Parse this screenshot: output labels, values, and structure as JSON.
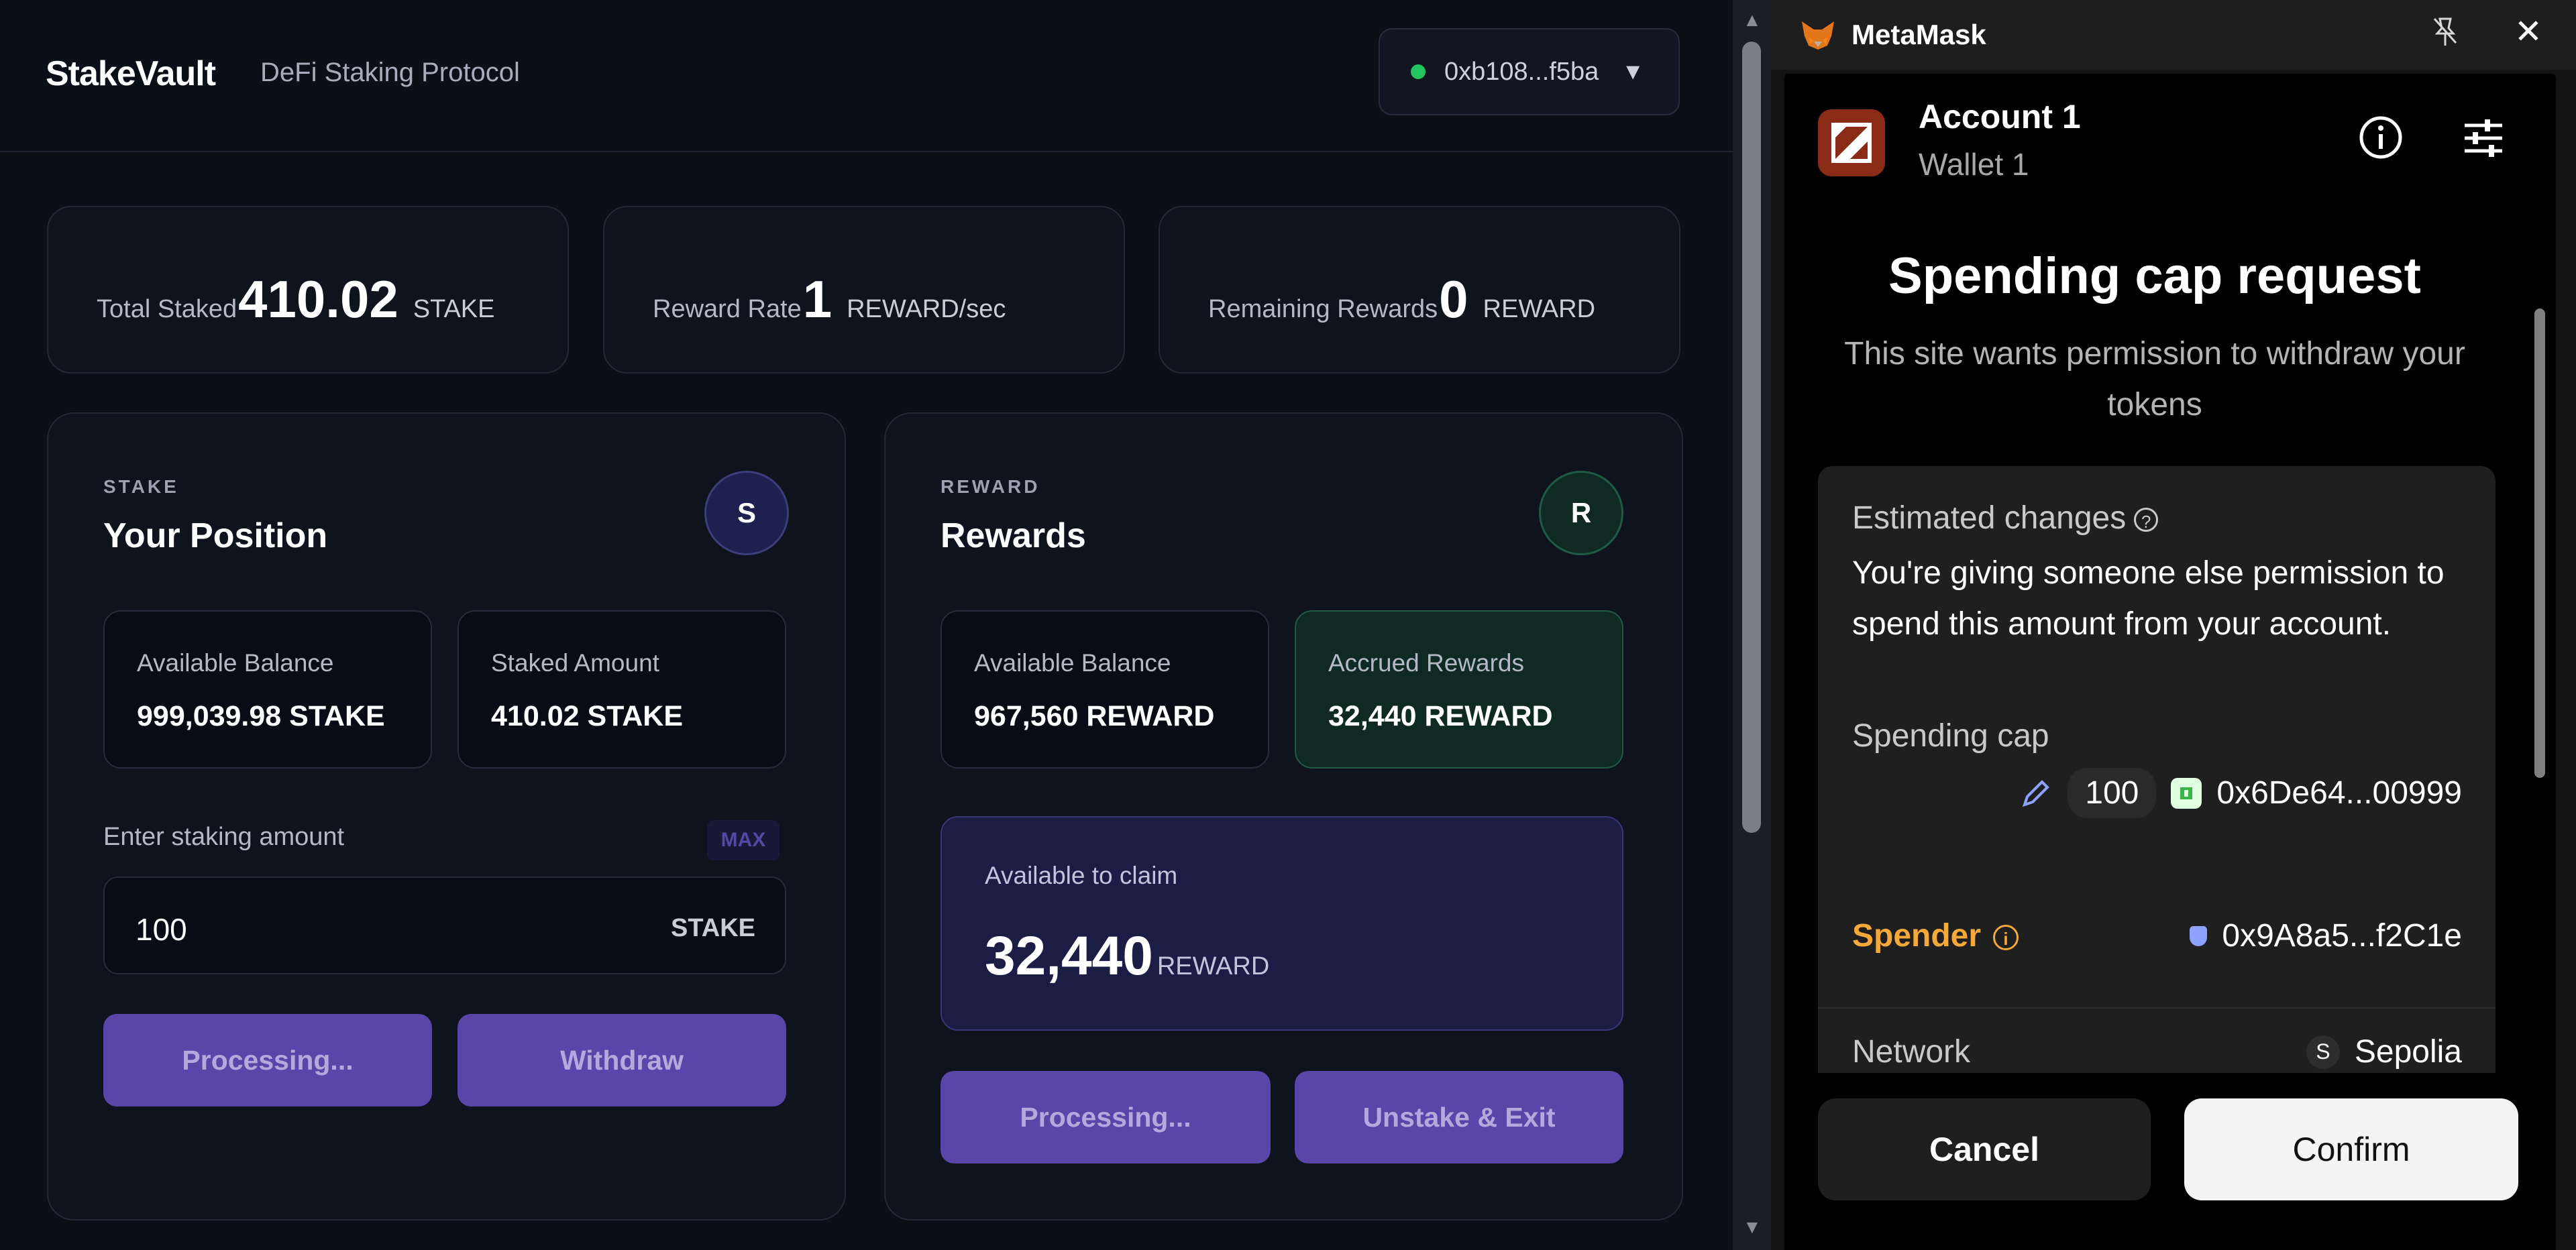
{
  "dapp": {
    "brand": "StakeVault",
    "tagline": "DeFi Staking Protocol",
    "wallet_address": "0xb108...f5ba",
    "stats": [
      {
        "label": "Total Staked",
        "value": "410.02",
        "unit": "STAKE"
      },
      {
        "label": "Reward Rate",
        "value": "1",
        "unit": "REWARD/sec"
      },
      {
        "label": "Remaining Rewards",
        "value": "0",
        "unit": "REWARD"
      }
    ],
    "stake_panel": {
      "eyebrow": "STAKE",
      "title": "Your Position",
      "badge": "S",
      "available_label": "Available Balance",
      "available_value": "999,039.98 STAKE",
      "staked_label": "Staked Amount",
      "staked_value": "410.02 STAKE",
      "input_label": "Enter staking amount",
      "max_label": "MAX",
      "input_value": "100",
      "input_unit": "STAKE",
      "primary_button": "Processing...",
      "secondary_button": "Withdraw"
    },
    "reward_panel": {
      "eyebrow": "REWARD",
      "title": "Rewards",
      "badge": "R",
      "available_label": "Available Balance",
      "available_value": "967,560 REWARD",
      "accrued_label": "Accrued Rewards",
      "accrued_value": "32,440 REWARD",
      "claim_label": "Available to claim",
      "claim_value": "32,440",
      "claim_unit": "REWARD",
      "primary_button": "Processing...",
      "secondary_button": "Unstake & Exit"
    }
  },
  "metamask": {
    "window_title": "MetaMask",
    "account_name": "Account 1",
    "wallet_name": "Wallet 1",
    "request_title": "Spending cap request",
    "request_subtitle": "This site wants permission to withdraw your tokens",
    "estimated_changes_label": "Estimated changes",
    "permission_text": "You're giving someone else permission to spend this amount from your account.",
    "spending_cap_label": "Spending cap",
    "spending_cap_value": "100",
    "token_address": "0x6De64...00999",
    "spender_label": "Spender",
    "spender_address": "0x9A8a5...f2C1e",
    "network_label": "Network",
    "network_badge": "S",
    "network_value": "Sepolia",
    "cancel_label": "Cancel",
    "confirm_label": "Confirm"
  },
  "icons": [
    "fox-icon",
    "pin-icon",
    "close-icon",
    "info-icon",
    "settings-sliders-icon",
    "help-icon",
    "edit-pencil-icon",
    "token-icon",
    "shield-icon",
    "chevron-down-icon"
  ],
  "colors": {
    "dapp_bg": "#0b0f18",
    "accent_purple": "#5a45a8",
    "online_green": "#22c55e",
    "spender_orange": "#f6a93b"
  }
}
